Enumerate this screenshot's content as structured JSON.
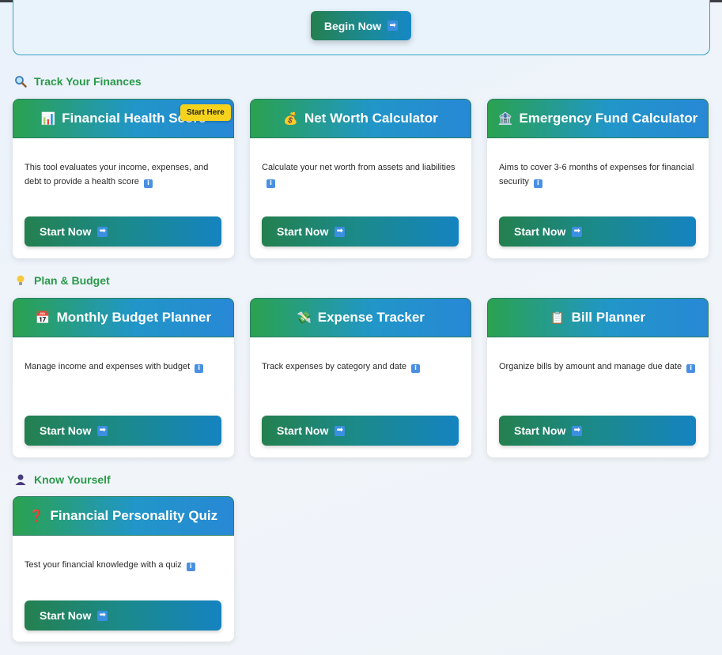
{
  "hero": {
    "begin_label": "Begin Now"
  },
  "sections": [
    {
      "title": "Track Your Finances",
      "icon": "magnifier-icon"
    },
    {
      "title": "Plan & Budget",
      "icon": "lightbulb-icon"
    },
    {
      "title": "Know Yourself",
      "icon": "person-icon"
    }
  ],
  "cards": [
    {
      "title": "Financial Health Score",
      "emoji": "📊",
      "desc": "This tool evaluates your income, expenses, and debt to provide a health score",
      "button": "Start Now",
      "badge": "Start Here"
    },
    {
      "title": "Net Worth Calculator",
      "emoji": "💰",
      "desc": "Calculate your net worth from assets and liabilities",
      "button": "Start Now"
    },
    {
      "title": "Emergency Fund Calculator",
      "emoji": "🏦",
      "desc": "Aims to cover 3-6 months of expenses for financial security",
      "button": "Start Now"
    },
    {
      "title": "Monthly Budget Planner",
      "emoji": "📅",
      "desc": "Manage income and expenses with budget",
      "button": "Start Now"
    },
    {
      "title": "Expense Tracker",
      "emoji": "💸",
      "desc": "Track expenses by category and date",
      "button": "Start Now"
    },
    {
      "title": "Bill Planner",
      "emoji": "📋",
      "desc": "Organize bills by amount and manage due date",
      "button": "Start Now"
    },
    {
      "title": "Financial Personality Quiz",
      "emoji": "❓",
      "desc": "Test your financial knowledge with a quiz",
      "button": "Start Now"
    }
  ],
  "icons": {
    "arrow": "➡",
    "info": "i"
  },
  "colors": {
    "accent_green": "#2b9a49",
    "accent_blue": "#2888d6",
    "badge": "#f5d31c"
  }
}
